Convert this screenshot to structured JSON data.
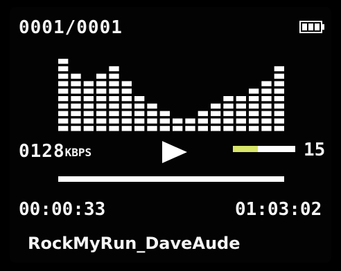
{
  "status": {
    "track_counter": "0001/0001",
    "battery_icon": "battery-full-icon"
  },
  "equalizer": {
    "levels": [
      10,
      8,
      7,
      8,
      9,
      7,
      5,
      4,
      3,
      2,
      2,
      3,
      4,
      5,
      5,
      6,
      7,
      9
    ],
    "max_level": 10
  },
  "info": {
    "bitrate_value": "0128",
    "bitrate_unit": "KBPS",
    "play_icon": "play-icon",
    "volume_level": "15",
    "volume_fraction": 0.4,
    "volume_colors": {
      "fill": "#d9e66a",
      "track": "#ffffff"
    }
  },
  "progress": {
    "fraction": 1.0
  },
  "time": {
    "elapsed": "00:00:33",
    "total": "01:03:02"
  },
  "song": {
    "title": "RockMyRun_DaveAude"
  }
}
